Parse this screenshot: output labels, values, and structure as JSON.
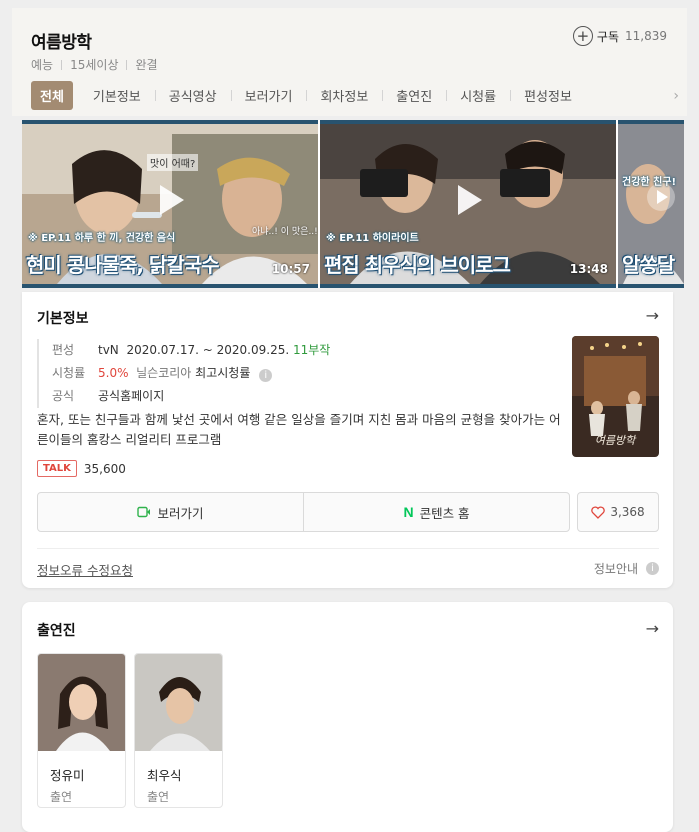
{
  "show": {
    "title": "여름방학",
    "subscribe_label": "구독",
    "subscribe_count": "11,839",
    "meta": [
      "예능",
      "15세이상",
      "완결"
    ]
  },
  "tabs": [
    "전체",
    "기본정보",
    "공식영상",
    "보러가기",
    "회차정보",
    "출연진",
    "시청률",
    "편성정보"
  ],
  "videos": [
    {
      "caption_small": "※ EP.11 하루 한 끼, 건강한 음식",
      "caption_big": "현미 콩나물죽, 닭칼국수",
      "duration": "10:57",
      "overlay1": "맛이 어때?",
      "overlay2": "아냐..! 이 맛은..!"
    },
    {
      "caption_small": "※ EP.11 하이라이트",
      "caption_big": "편집 최우식의 브이로그",
      "duration": "13:48"
    },
    {
      "caption_small": "건강한 친구!",
      "caption_big": "알쏭달"
    }
  ],
  "basic_info": {
    "title": "기본정보",
    "rows": {
      "schedule_label": "편성",
      "channel": "tvN",
      "dates": "2020.07.17. ~ 2020.09.25.",
      "episodes": "11부작",
      "rating_label": "시청률",
      "rating_value": "5.0%",
      "rating_source": "닐슨코리아",
      "rating_note": "최고시청률",
      "official_label": "공식",
      "official_link": "공식홈페이지"
    },
    "synopsis": "혼자, 또는 친구들과 함께 낯선 곳에서 여행 같은 일상을 즐기며 지친 몸과 마음의 균형을 찾아가는 어른이들의 홈캉스 리얼리티 프로그램",
    "talk_badge": "TALK",
    "talk_count": "35,600",
    "watch_button": "보러가기",
    "content_home_button": "콘텐츠 홈",
    "like_count": "3,368",
    "report_link": "정보오류 수정요청",
    "info_guide": "정보안내",
    "poster_title": "여름방학"
  },
  "cast": {
    "title": "출연진",
    "members": [
      {
        "name": "정유미",
        "role": "출연"
      },
      {
        "name": "최우식",
        "role": "출연"
      }
    ]
  },
  "colors": {
    "active_tab": "#a38b72",
    "green": "#2f9a3c",
    "red": "#e0463c",
    "naver_green": "#03c75a"
  }
}
